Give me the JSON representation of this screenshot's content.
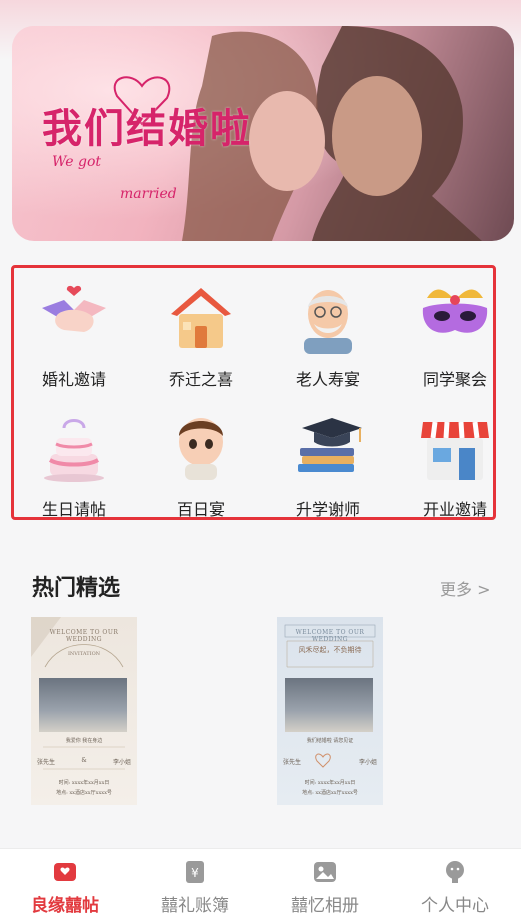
{
  "banner": {
    "title": "我们结婚啦",
    "we_got": "We got",
    "married": "married",
    "slides": 3,
    "active_slide": 1
  },
  "categories": [
    {
      "label": "婚礼邀请",
      "icon": "handshake-icon"
    },
    {
      "label": "乔迁之喜",
      "icon": "house-icon"
    },
    {
      "label": "老人寿宴",
      "icon": "grandpa-icon"
    },
    {
      "label": "同学聚会",
      "icon": "party-mask-icon"
    },
    {
      "label": "生日请帖",
      "icon": "birthday-cake-icon"
    },
    {
      "label": "百日宴",
      "icon": "baby-icon"
    },
    {
      "label": "升学谢师",
      "icon": "graduation-cap-icon"
    },
    {
      "label": "开业邀请",
      "icon": "storefront-icon"
    }
  ],
  "section": {
    "title": "热门精选",
    "more": "更多 >"
  },
  "cards": [
    {
      "header": "WELCOME TO OUR WEDDING",
      "sub": "INVITATION",
      "line1": "我爱你",
      "line2": "我在身边",
      "groom": "张先生",
      "amp": "&",
      "bride": "李小姐",
      "time": "时间: xxxx年xx月xx日",
      "place": "地点: xx酒店xx厅xxxx号"
    },
    {
      "header": "WELCOME TO OUR WEDDING",
      "sub": "风禾尽起，不负期待",
      "line1": "我们结婚啦",
      "line2": "请您见证",
      "groom": "张先生",
      "bride": "李小姐",
      "time": "时间: xxxx年xx月xx日",
      "place": "地点: xx酒店xx厅xxxx号"
    }
  ],
  "tabs": [
    {
      "label": "良缘囍帖",
      "icon": "invitation-icon",
      "active": true
    },
    {
      "label": "囍礼账簿",
      "icon": "ledger-icon",
      "active": false
    },
    {
      "label": "囍忆相册",
      "icon": "album-icon",
      "active": false
    },
    {
      "label": "个人中心",
      "icon": "profile-icon",
      "active": false
    }
  ],
  "colors": {
    "accent": "#e23a3f",
    "banner_text": "#d6246a",
    "highlight_border": "#e5333a"
  }
}
